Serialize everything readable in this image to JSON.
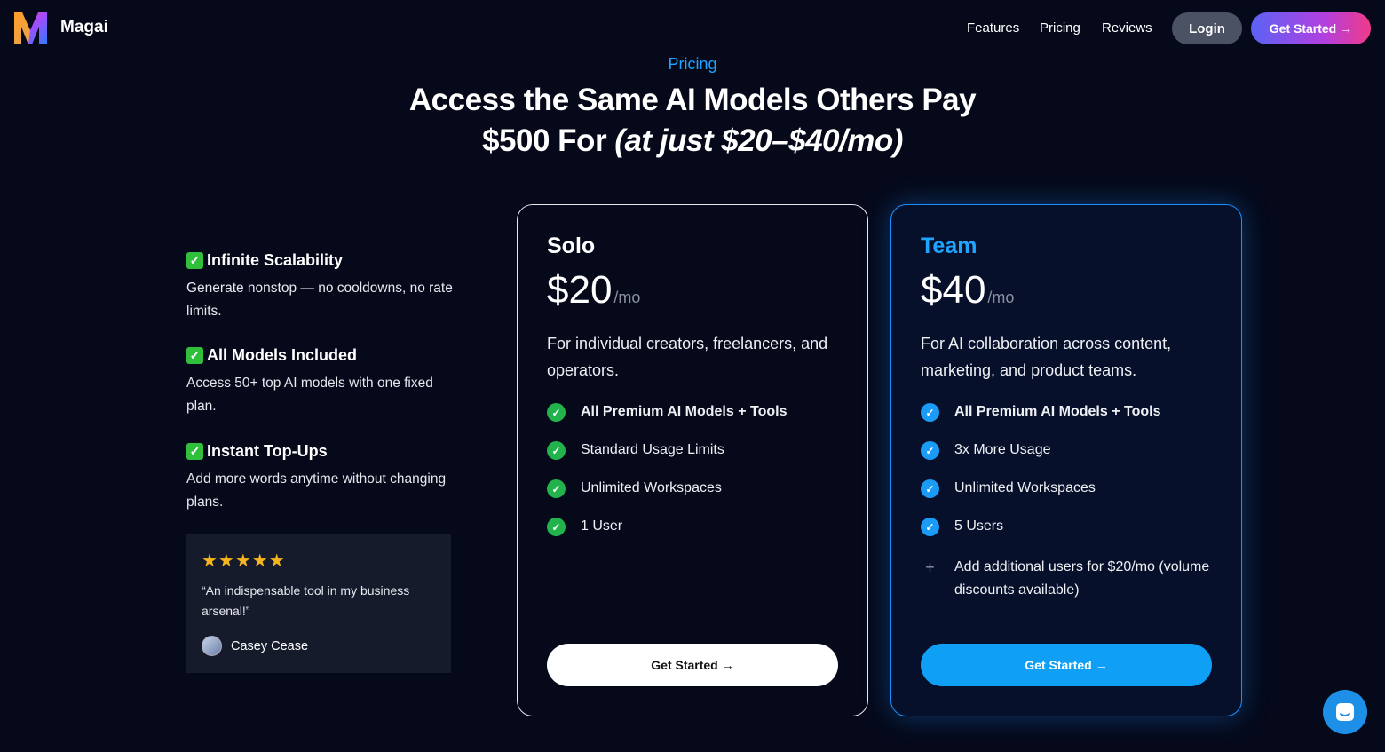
{
  "nav": {
    "brand": "Magai",
    "links": [
      "Features",
      "Pricing",
      "Reviews"
    ],
    "login": "Login",
    "get_started": "Get Started"
  },
  "hero": {
    "eyebrow": "Pricing",
    "headline_1": "Access the Same AI Models Others Pay",
    "headline_2": "$500 For ",
    "headline_em": "(at just $20–$40/mo)"
  },
  "highlights": [
    {
      "title": "Infinite Scalability",
      "desc": "Generate nonstop — no cooldowns, no rate limits."
    },
    {
      "title": "All Models Included",
      "desc": "Access 50+ top AI models with one fixed plan."
    },
    {
      "title": "Instant Top-Ups",
      "desc": "Add more words anytime without changing plans."
    }
  ],
  "review": {
    "stars": "★★★★★",
    "quote": "“An indispensable tool in my business arsenal!”",
    "author": "Casey Cease"
  },
  "plans": {
    "solo": {
      "name": "Solo",
      "price": "$20",
      "per": "/mo",
      "desc": "For individual creators, freelancers, and operators.",
      "features": [
        "All Premium AI Models + Tools",
        "Standard Usage Limits",
        "Unlimited Workspaces",
        "1 User"
      ],
      "cta": "Get Started"
    },
    "team": {
      "name": "Team",
      "price": "$40",
      "per": "/mo",
      "desc": "For AI collaboration across content, marketing, and product teams.",
      "features": [
        "All Premium AI Models + Tools",
        "3x More Usage",
        "Unlimited Workspaces",
        "5 Users"
      ],
      "addon": "Add additional users for $20/mo (volume discounts available)",
      "cta": "Get Started"
    }
  },
  "colors": {
    "background": "#05091a",
    "accent_blue": "#1fa4ff",
    "check_green": "#22b34d",
    "star": "#f6b51e"
  },
  "icons": {
    "arrow": "→",
    "check": "✓",
    "plus": "+"
  }
}
